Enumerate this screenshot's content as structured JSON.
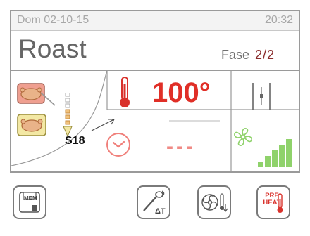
{
  "status": {
    "date": "Dom 02-10-15",
    "time": "20:32"
  },
  "program": {
    "name": "Roast",
    "phase_label": "Fase",
    "phase_value": "2/2"
  },
  "cooking": {
    "temperature": "100°",
    "time": "---",
    "step": "S18",
    "fan_levels": 5
  },
  "icons": {
    "food_probe": "roast-chicken-icon",
    "food_tray": "roast-chicken-tray-icon",
    "thermometer": "thermometer-icon",
    "timer": "clock-icon",
    "humidity": "vent-slider-icon",
    "fan": "fan-icon"
  },
  "buttons": {
    "mem": "MEM",
    "preheat_line1": "PRE",
    "preheat_line2": "HEAT"
  },
  "colors": {
    "accent_red": "#e02f27",
    "fan_green": "#8fd26b",
    "panel_border": "#9a9a9a"
  }
}
